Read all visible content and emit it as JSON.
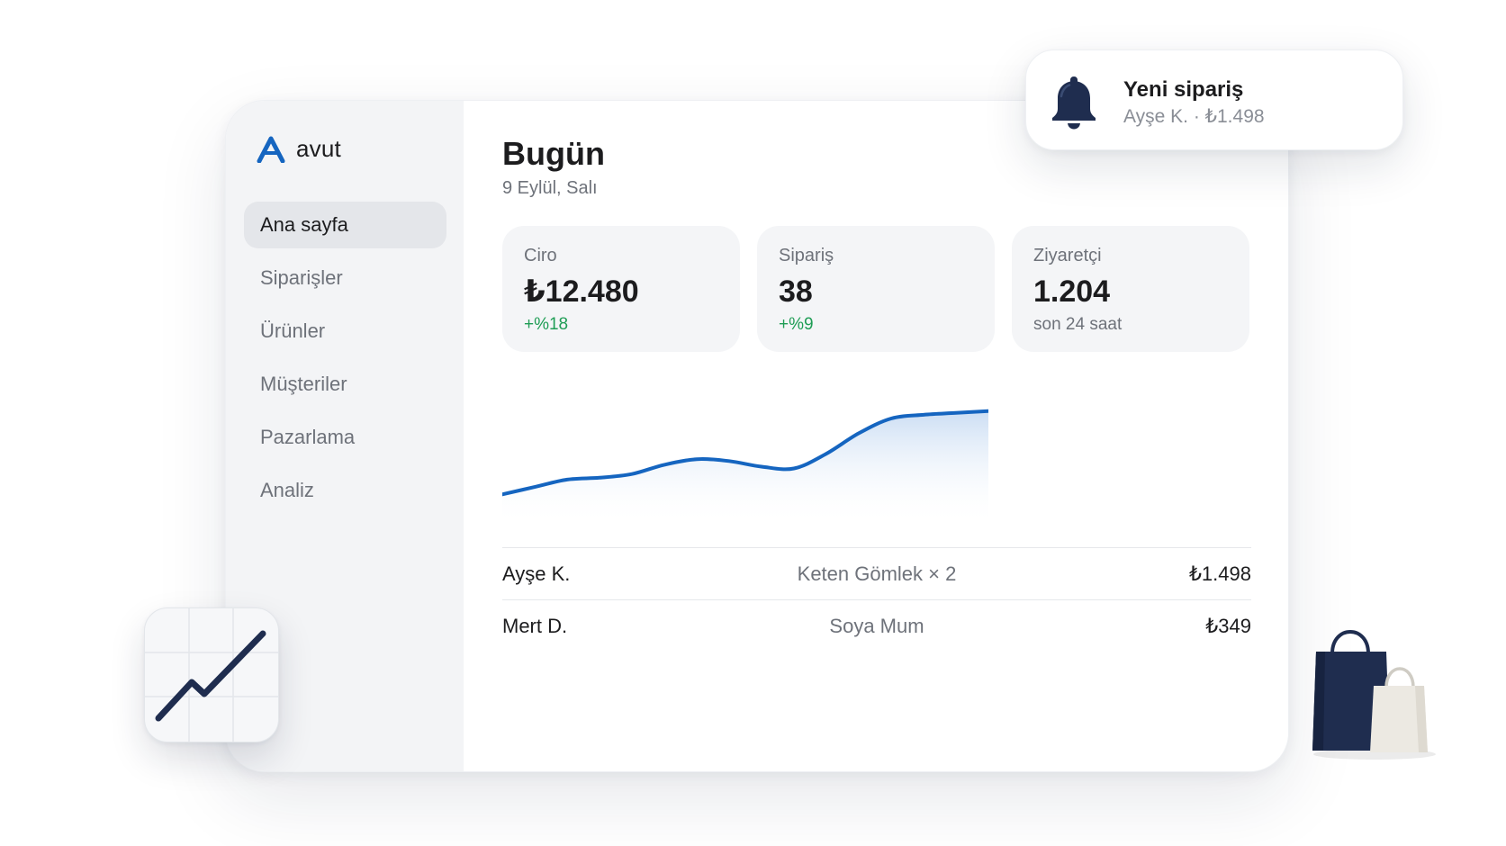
{
  "brand": {
    "name": "avut",
    "logo_icon": "brand-a-icon"
  },
  "sidebar": {
    "items": [
      {
        "label": "Ana sayfa",
        "active": true
      },
      {
        "label": "Siparişler",
        "active": false
      },
      {
        "label": "Ürünler",
        "active": false
      },
      {
        "label": "Müşteriler",
        "active": false
      },
      {
        "label": "Pazarlama",
        "active": false
      },
      {
        "label": "Analiz",
        "active": false
      }
    ]
  },
  "header": {
    "title": "Bugün",
    "date": "9 Eylül, Salı"
  },
  "stats": [
    {
      "label": "Ciro",
      "value": "₺12.480",
      "sub": "+%18",
      "trend": "up"
    },
    {
      "label": "Sipariş",
      "value": "38",
      "sub": "+%9",
      "trend": "up"
    },
    {
      "label": "Ziyaretçi",
      "value": "1.204",
      "sub": "son 24 saat",
      "trend": "neutral"
    }
  ],
  "chart_data": {
    "type": "area",
    "x": [
      0,
      1,
      2,
      3,
      4,
      5,
      6,
      7,
      8,
      9,
      10,
      11,
      12,
      13,
      14,
      15
    ],
    "values": [
      12,
      16,
      20,
      21,
      23,
      28,
      31,
      30,
      27,
      26,
      34,
      45,
      53,
      55,
      56,
      57
    ],
    "ylim": [
      0,
      70
    ],
    "grid": false,
    "line_color": "#1565c0",
    "fill_color": "#cfe0f5"
  },
  "orders": [
    {
      "customer": "Ayşe K.",
      "item": "Keten Gömlek × 2",
      "total": "₺1.498"
    },
    {
      "customer": "Mert D.",
      "item": "Soya Mum",
      "total": "₺349"
    }
  ],
  "notification": {
    "icon": "bell-icon",
    "title": "Yeni sipariş",
    "text": "Ayşe K. · ₺1.498"
  },
  "decorations": {
    "trend_tile_icon": "trend-up-icon",
    "bags_icon": "shopping-bags-icon"
  },
  "colors": {
    "accent": "#1565c0",
    "positive": "#1f9d55",
    "navy": "#1f2d4f"
  }
}
